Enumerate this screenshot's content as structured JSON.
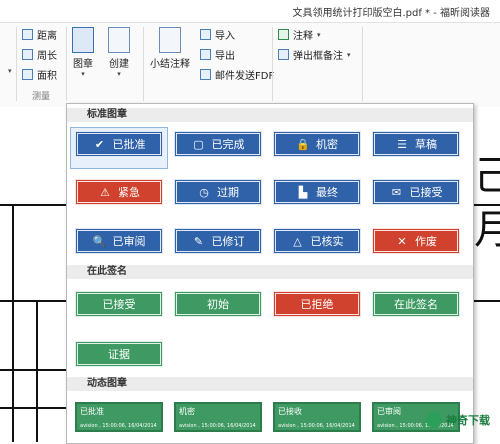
{
  "window": {
    "title": "文具领用统计打印版空白.pdf * - 福昕阅读器"
  },
  "ribbon": {
    "measure": {
      "distance": "距离",
      "perimeter": "周长",
      "area": "面积",
      "group": "测量"
    },
    "stamp_button": "图章",
    "create_button": "创建",
    "summary_button": "小结注释",
    "import": "导入",
    "export": "导出",
    "email_pdf": "邮件发送FDF",
    "annotation": "注释",
    "popup_note": "弹出框备注"
  },
  "panel": {
    "standard_title": "标准图章",
    "standard": [
      {
        "label": "已批准",
        "color": "blue",
        "icon": "check-icon"
      },
      {
        "label": "已完成",
        "color": "blue",
        "icon": "document-check-icon"
      },
      {
        "label": "机密",
        "color": "blue",
        "icon": "lock-icon"
      },
      {
        "label": "草稿",
        "color": "blue",
        "icon": "document-lines-icon"
      },
      {
        "label": "紧急",
        "color": "red",
        "icon": "warning-icon"
      },
      {
        "label": "过期",
        "color": "blue",
        "icon": "clock-icon"
      },
      {
        "label": "最终",
        "color": "blue",
        "icon": "stamp-icon"
      },
      {
        "label": "已接受",
        "color": "blue",
        "icon": "envelope-icon"
      },
      {
        "label": "已审阅",
        "color": "blue",
        "icon": "magnifier-icon"
      },
      {
        "label": "已修订",
        "color": "blue",
        "icon": "pencil-icon"
      },
      {
        "label": "已核实",
        "color": "blue",
        "icon": "triangle-icon"
      },
      {
        "label": "作废",
        "color": "red",
        "icon": "cross-icon"
      }
    ],
    "sign_title": "在此签名",
    "sign": [
      {
        "label": "已接受",
        "color": "green"
      },
      {
        "label": "初始",
        "color": "green"
      },
      {
        "label": "已拒绝",
        "color": "red"
      },
      {
        "label": "在此签名",
        "color": "green"
      },
      {
        "label": "证据",
        "color": "green"
      }
    ],
    "dynamic_title": "动态图章",
    "dynamic": [
      {
        "label": "已批准",
        "sub": "avision , 15:00:06, 16/04/2014"
      },
      {
        "label": "机密",
        "sub": "avision , 15:00:06, 16/04/2014"
      },
      {
        "label": "已接收",
        "sub": "avision , 15:00:06, 16/04/2014"
      },
      {
        "label": "已审阅",
        "sub": "avision , 15:00:06, 16/04/2014"
      }
    ]
  },
  "document": {
    "glyph_right_top": "己",
    "glyph_right_mid": "月"
  },
  "watermark": {
    "text": "神奇下载"
  }
}
